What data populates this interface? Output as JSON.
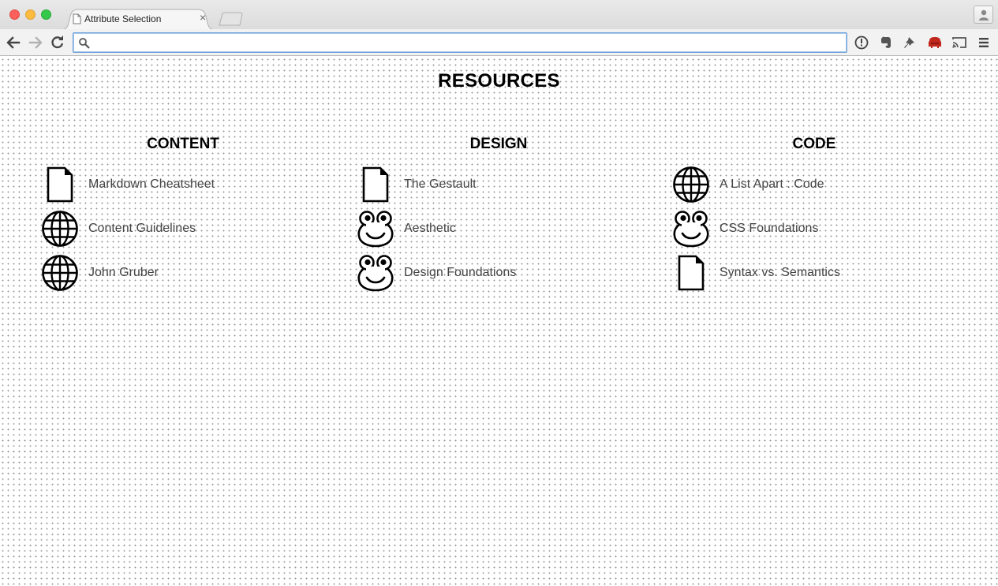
{
  "browser": {
    "tab_title": "Attribute Selection",
    "address_value": "",
    "address_placeholder": ""
  },
  "page": {
    "title": "RESOURCES",
    "columns": [
      {
        "heading": "CONTENT",
        "items": [
          {
            "label": "Markdown Cheatsheet",
            "icon": "document-icon"
          },
          {
            "label": "Content Guidelines",
            "icon": "globe-icon"
          },
          {
            "label": "John Gruber",
            "icon": "globe-icon"
          }
        ]
      },
      {
        "heading": "DESIGN",
        "items": [
          {
            "label": "The Gestault",
            "icon": "document-icon"
          },
          {
            "label": "Aesthetic",
            "icon": "frog-icon"
          },
          {
            "label": "Design Foundations",
            "icon": "frog-icon"
          }
        ]
      },
      {
        "heading": "CODE",
        "items": [
          {
            "label": "A List Apart : Code",
            "icon": "globe-icon"
          },
          {
            "label": "CSS Foundations",
            "icon": "frog-icon"
          },
          {
            "label": "Syntax vs. Semantics",
            "icon": "document-icon"
          }
        ]
      }
    ]
  },
  "colors": {
    "window_close": "#fc605c",
    "window_minimize": "#fdbc40",
    "window_maximize": "#34c84a",
    "omnibox_focus": "#6b9fd8",
    "extension_red": "#c0281d",
    "link_text": "#444444"
  }
}
